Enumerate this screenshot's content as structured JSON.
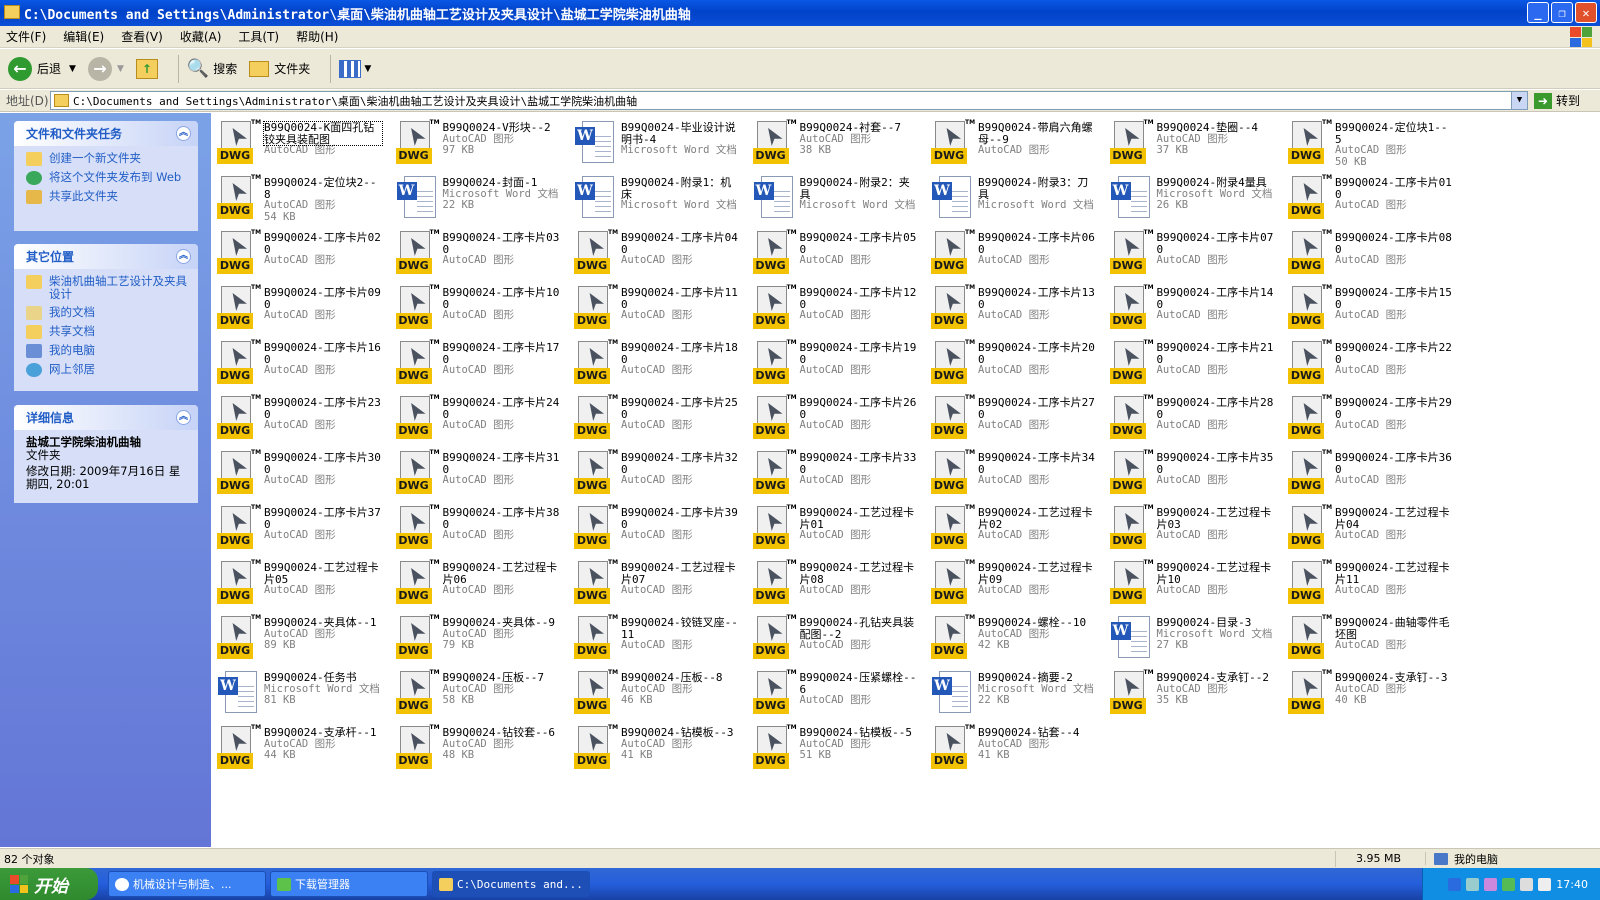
{
  "window": {
    "title": "C:\\Documents and Settings\\Administrator\\桌面\\柴油机曲轴工艺设计及夹具设计\\盐城工学院柴油机曲轴"
  },
  "menu": [
    "文件(F)",
    "编辑(E)",
    "查看(V)",
    "收藏(A)",
    "工具(T)",
    "帮助(H)"
  ],
  "toolbar": {
    "back": "后退",
    "search": "搜索",
    "folders": "文件夹"
  },
  "address": {
    "label": "地址(D)",
    "path": "C:\\Documents and Settings\\Administrator\\桌面\\柴油机曲轴工艺设计及夹具设计\\盐城工学院柴油机曲轴",
    "go": "转到"
  },
  "tasks": {
    "title": "文件和文件夹任务",
    "items": [
      "创建一个新文件夹",
      "将这个文件夹发布到 Web",
      "共享此文件夹"
    ]
  },
  "places": {
    "title": "其它位置",
    "items": [
      "柴油机曲轴工艺设计及夹具设计",
      "我的文档",
      "共享文档",
      "我的电脑",
      "网上邻居"
    ]
  },
  "details": {
    "title": "详细信息",
    "name": "盐城工学院柴油机曲轴",
    "type": "文件夹",
    "modified": "修改日期: 2009年7月16日 星期四, 20:01"
  },
  "files": [
    {
      "name": "B99Q0024-K面四孔钻铰夹具装配图",
      "type": "AutoCAD 图形",
      "size": ""
    },
    {
      "name": "B99Q0024-V形块--2",
      "type": "AutoCAD 图形",
      "size": "97 KB"
    },
    {
      "name": "B99Q0024-毕业设计说明书-4",
      "type": "Microsoft Word 文档",
      "size": ""
    },
    {
      "name": "B99Q0024-衬套--7",
      "type": "AutoCAD 图形",
      "size": "38 KB"
    },
    {
      "name": "B99Q0024-带肩六角螺母--9",
      "type": "AutoCAD 图形",
      "size": ""
    },
    {
      "name": "B99Q0024-垫圈--4",
      "type": "AutoCAD 图形",
      "size": "37 KB"
    },
    {
      "name": "B99Q0024-定位块1--5",
      "type": "AutoCAD 图形",
      "size": "50 KB"
    },
    {
      "name": "B99Q0024-定位块2--8",
      "type": "AutoCAD 图形",
      "size": "54 KB"
    },
    {
      "name": "B99Q0024-封面-1",
      "type": "Microsoft Word 文档",
      "size": "22 KB"
    },
    {
      "name": "B99Q0024-附录1：机床",
      "type": "Microsoft Word 文档",
      "size": ""
    },
    {
      "name": "B99Q0024-附录2：夹具",
      "type": "Microsoft Word 文档",
      "size": ""
    },
    {
      "name": "B99Q0024-附录3：刀具",
      "type": "Microsoft Word 文档",
      "size": ""
    },
    {
      "name": "B99Q0024-附录4量具",
      "type": "Microsoft Word 文档",
      "size": "26 KB"
    },
    {
      "name": "B99Q0024-工序卡片010",
      "type": "AutoCAD 图形",
      "size": ""
    },
    {
      "name": "B99Q0024-工序卡片020",
      "type": "AutoCAD 图形",
      "size": ""
    },
    {
      "name": "B99Q0024-工序卡片030",
      "type": "AutoCAD 图形",
      "size": ""
    },
    {
      "name": "B99Q0024-工序卡片040",
      "type": "AutoCAD 图形",
      "size": ""
    },
    {
      "name": "B99Q0024-工序卡片050",
      "type": "AutoCAD 图形",
      "size": ""
    },
    {
      "name": "B99Q0024-工序卡片060",
      "type": "AutoCAD 图形",
      "size": ""
    },
    {
      "name": "B99Q0024-工序卡片070",
      "type": "AutoCAD 图形",
      "size": ""
    },
    {
      "name": "B99Q0024-工序卡片080",
      "type": "AutoCAD 图形",
      "size": ""
    },
    {
      "name": "B99Q0024-工序卡片090",
      "type": "AutoCAD 图形",
      "size": ""
    },
    {
      "name": "B99Q0024-工序卡片100",
      "type": "AutoCAD 图形",
      "size": ""
    },
    {
      "name": "B99Q0024-工序卡片110",
      "type": "AutoCAD 图形",
      "size": ""
    },
    {
      "name": "B99Q0024-工序卡片120",
      "type": "AutoCAD 图形",
      "size": ""
    },
    {
      "name": "B99Q0024-工序卡片130",
      "type": "AutoCAD 图形",
      "size": ""
    },
    {
      "name": "B99Q0024-工序卡片140",
      "type": "AutoCAD 图形",
      "size": ""
    },
    {
      "name": "B99Q0024-工序卡片150",
      "type": "AutoCAD 图形",
      "size": ""
    },
    {
      "name": "B99Q0024-工序卡片160",
      "type": "AutoCAD 图形",
      "size": ""
    },
    {
      "name": "B99Q0024-工序卡片170",
      "type": "AutoCAD 图形",
      "size": ""
    },
    {
      "name": "B99Q0024-工序卡片180",
      "type": "AutoCAD 图形",
      "size": ""
    },
    {
      "name": "B99Q0024-工序卡片190",
      "type": "AutoCAD 图形",
      "size": ""
    },
    {
      "name": "B99Q0024-工序卡片200",
      "type": "AutoCAD 图形",
      "size": ""
    },
    {
      "name": "B99Q0024-工序卡片210",
      "type": "AutoCAD 图形",
      "size": ""
    },
    {
      "name": "B99Q0024-工序卡片220",
      "type": "AutoCAD 图形",
      "size": ""
    },
    {
      "name": "B99Q0024-工序卡片230",
      "type": "AutoCAD 图形",
      "size": ""
    },
    {
      "name": "B99Q0024-工序卡片240",
      "type": "AutoCAD 图形",
      "size": ""
    },
    {
      "name": "B99Q0024-工序卡片250",
      "type": "AutoCAD 图形",
      "size": ""
    },
    {
      "name": "B99Q0024-工序卡片260",
      "type": "AutoCAD 图形",
      "size": ""
    },
    {
      "name": "B99Q0024-工序卡片270",
      "type": "AutoCAD 图形",
      "size": ""
    },
    {
      "name": "B99Q0024-工序卡片280",
      "type": "AutoCAD 图形",
      "size": ""
    },
    {
      "name": "B99Q0024-工序卡片290",
      "type": "AutoCAD 图形",
      "size": ""
    },
    {
      "name": "B99Q0024-工序卡片300",
      "type": "AutoCAD 图形",
      "size": ""
    },
    {
      "name": "B99Q0024-工序卡片310",
      "type": "AutoCAD 图形",
      "size": ""
    },
    {
      "name": "B99Q0024-工序卡片320",
      "type": "AutoCAD 图形",
      "size": ""
    },
    {
      "name": "B99Q0024-工序卡片330",
      "type": "AutoCAD 图形",
      "size": ""
    },
    {
      "name": "B99Q0024-工序卡片340",
      "type": "AutoCAD 图形",
      "size": ""
    },
    {
      "name": "B99Q0024-工序卡片350",
      "type": "AutoCAD 图形",
      "size": ""
    },
    {
      "name": "B99Q0024-工序卡片360",
      "type": "AutoCAD 图形",
      "size": ""
    },
    {
      "name": "B99Q0024-工序卡片370",
      "type": "AutoCAD 图形",
      "size": ""
    },
    {
      "name": "B99Q0024-工序卡片380",
      "type": "AutoCAD 图形",
      "size": ""
    },
    {
      "name": "B99Q0024-工序卡片390",
      "type": "AutoCAD 图形",
      "size": ""
    },
    {
      "name": "B99Q0024-工艺过程卡片01",
      "type": "AutoCAD 图形",
      "size": ""
    },
    {
      "name": "B99Q0024-工艺过程卡片02",
      "type": "AutoCAD 图形",
      "size": ""
    },
    {
      "name": "B99Q0024-工艺过程卡片03",
      "type": "AutoCAD 图形",
      "size": ""
    },
    {
      "name": "B99Q0024-工艺过程卡片04",
      "type": "AutoCAD 图形",
      "size": ""
    },
    {
      "name": "B99Q0024-工艺过程卡片05",
      "type": "AutoCAD 图形",
      "size": ""
    },
    {
      "name": "B99Q0024-工艺过程卡片06",
      "type": "AutoCAD 图形",
      "size": ""
    },
    {
      "name": "B99Q0024-工艺过程卡片07",
      "type": "AutoCAD 图形",
      "size": ""
    },
    {
      "name": "B99Q0024-工艺过程卡片08",
      "type": "AutoCAD 图形",
      "size": ""
    },
    {
      "name": "B99Q0024-工艺过程卡片09",
      "type": "AutoCAD 图形",
      "size": ""
    },
    {
      "name": "B99Q0024-工艺过程卡片10",
      "type": "AutoCAD 图形",
      "size": ""
    },
    {
      "name": "B99Q0024-工艺过程卡片11",
      "type": "AutoCAD 图形",
      "size": ""
    },
    {
      "name": "B99Q0024-夹具体--1",
      "type": "AutoCAD 图形",
      "size": "89 KB"
    },
    {
      "name": "B99Q0024-夹具体--9",
      "type": "AutoCAD 图形",
      "size": "79 KB"
    },
    {
      "name": "B99Q0024-铰链叉座--11",
      "type": "AutoCAD 图形",
      "size": ""
    },
    {
      "name": "B99Q0024-孔钻夹具装配图--2",
      "type": "AutoCAD 图形",
      "size": ""
    },
    {
      "name": "B99Q0024-螺栓--10",
      "type": "AutoCAD 图形",
      "size": "42 KB"
    },
    {
      "name": "B99Q0024-目录-3",
      "type": "Microsoft Word 文档",
      "size": "27 KB"
    },
    {
      "name": "B99Q0024-曲轴零件毛坯图",
      "type": "AutoCAD 图形",
      "size": ""
    },
    {
      "name": "B99Q0024-任务书",
      "type": "Microsoft Word 文档",
      "size": "81 KB"
    },
    {
      "name": "B99Q0024-压板--7",
      "type": "AutoCAD 图形",
      "size": "58 KB"
    },
    {
      "name": "B99Q0024-压板--8",
      "type": "AutoCAD 图形",
      "size": "46 KB"
    },
    {
      "name": "B99Q0024-压紧螺栓--6",
      "type": "AutoCAD 图形",
      "size": ""
    },
    {
      "name": "B99Q0024-摘要-2",
      "type": "Microsoft Word 文档",
      "size": "22 KB"
    },
    {
      "name": "B99Q0024-支承钉--2",
      "type": "AutoCAD 图形",
      "size": "35 KB"
    },
    {
      "name": "B99Q0024-支承钉--3",
      "type": "AutoCAD 图形",
      "size": "40 KB"
    },
    {
      "name": "B99Q0024-支承杆--1",
      "type": "AutoCAD 图形",
      "size": "44 KB"
    },
    {
      "name": "B99Q0024-钻铰套--6",
      "type": "AutoCAD 图形",
      "size": "48 KB"
    },
    {
      "name": "B99Q0024-钻模板--3",
      "type": "AutoCAD 图形",
      "size": "41 KB"
    },
    {
      "name": "B99Q0024-钻模板--5",
      "type": "AutoCAD 图形",
      "size": "51 KB"
    },
    {
      "name": "B99Q0024-钻套--4",
      "type": "AutoCAD 图形",
      "size": "41 KB"
    }
  ],
  "status": {
    "count": "82 个对象",
    "size": "3.95 MB",
    "location": "我的电脑"
  },
  "taskbar": {
    "start": "开始",
    "tasks": [
      "机械设计与制造、...",
      "下载管理器",
      "C:\\Documents and..."
    ],
    "clock": "17:40"
  },
  "colors": {
    "title_blue": "#0a58e6",
    "dwg_yellow": "#f2c200",
    "word_blue": "#2458b8",
    "start_green": "#3c9a3a"
  }
}
